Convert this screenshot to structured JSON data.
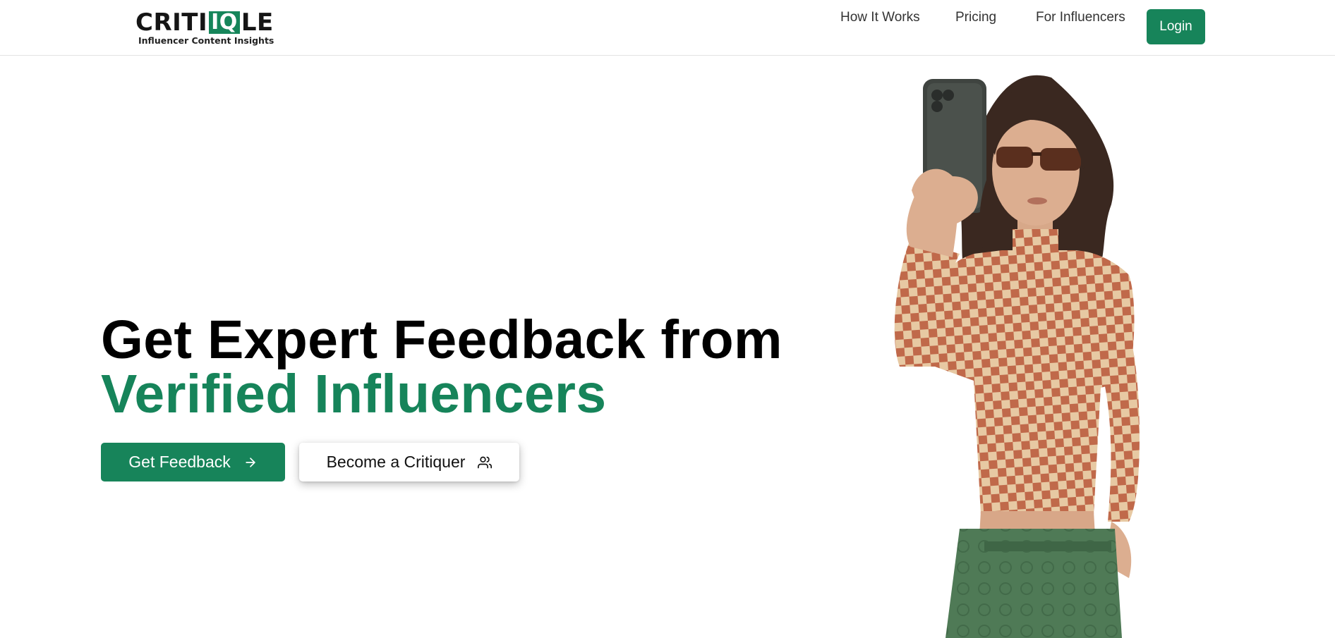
{
  "brand": {
    "logo_prefix": "CRITI",
    "logo_highlight": "IQ",
    "logo_suffix": "LE",
    "tagline": "Influencer Content Insights",
    "accent_color": "#17845a"
  },
  "nav": {
    "links": [
      "How It Works",
      "Pricing",
      "For Influencers"
    ],
    "login_label": "Login"
  },
  "hero": {
    "title_line1": "Get Expert Feedback from",
    "title_line2": "Verified Influencers",
    "primary_button": {
      "label": "Get Feedback",
      "icon": "arrow-right-icon"
    },
    "secondary_button": {
      "label": "Become a Critiquer",
      "icon": "users-icon"
    },
    "image": {
      "description_icon": "influencer-selfie-photo"
    }
  }
}
